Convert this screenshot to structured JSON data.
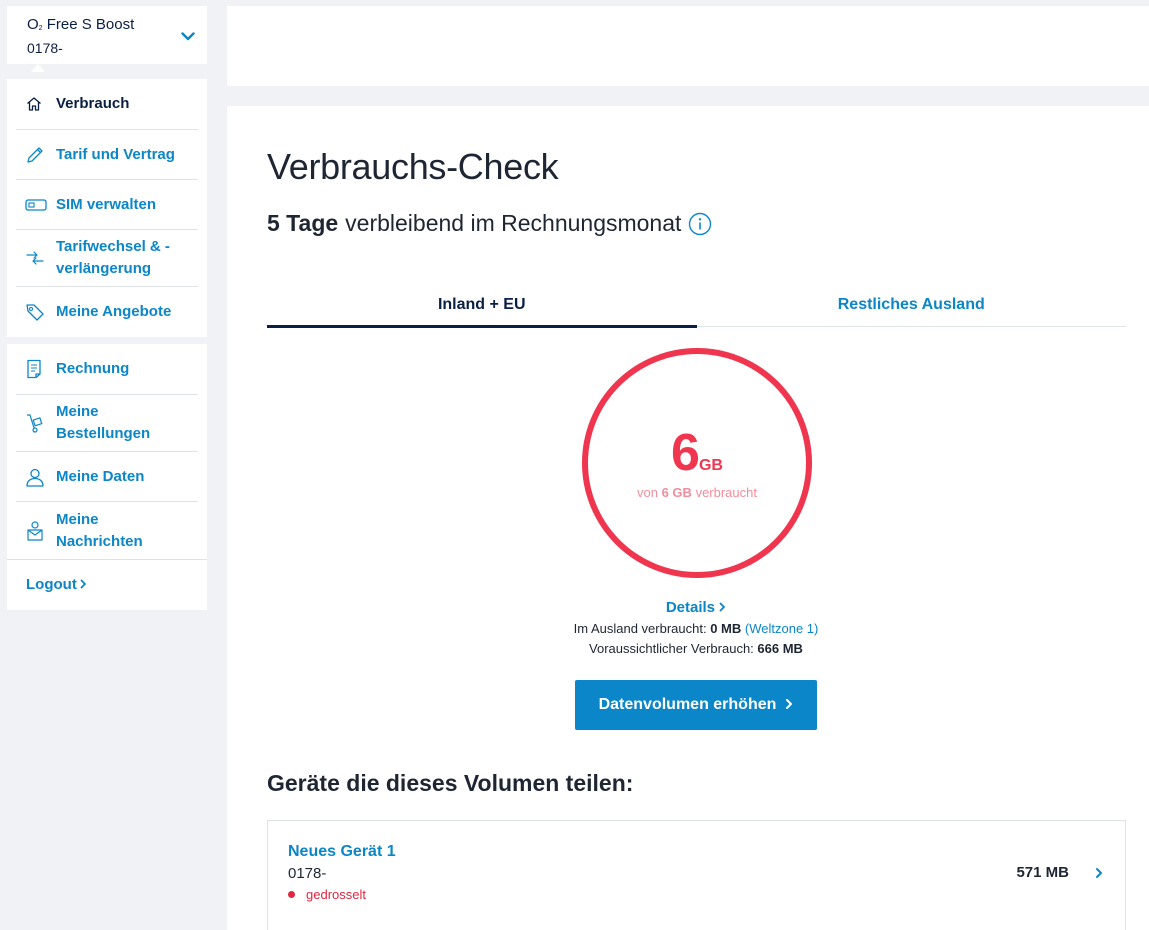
{
  "tariff": {
    "name_prefix": "O",
    "name_sub": "2",
    "name_rest": " Free S Boost",
    "number": "0178-"
  },
  "sidebar": {
    "items": [
      {
        "label": "Verbrauch",
        "icon": "home-icon",
        "active": true
      },
      {
        "label": "Tarif und Vertrag",
        "icon": "pencil-icon"
      },
      {
        "label": "SIM verwalten",
        "icon": "sim-card-icon"
      },
      {
        "label": "Tarifwechsel & -verlängerung",
        "line1": "Tarifwechsel & -",
        "line2": "verlängerung",
        "icon": "swap-icon"
      },
      {
        "label": "Meine Angebote",
        "icon": "tag-icon"
      }
    ],
    "items2": [
      {
        "label": "Rechnung",
        "icon": "invoice-icon"
      },
      {
        "label": "Meine Bestellungen",
        "line1": "Meine",
        "line2": "Bestellungen",
        "icon": "hand-truck-icon"
      },
      {
        "label": "Meine Daten",
        "icon": "user-icon"
      },
      {
        "label": "Meine Nachrichten",
        "line1": "Meine",
        "line2": "Nachrichten",
        "icon": "message-icon"
      }
    ],
    "logout": "Logout"
  },
  "main": {
    "title": "Verbrauchs-Check",
    "remaining_bold": "5 Tage",
    "remaining_text": "verbleibend im Rechnungsmonat",
    "tabs": [
      {
        "label": "Inland + EU",
        "active": true
      },
      {
        "label": "Restliches Ausland",
        "active": false
      }
    ],
    "gauge": {
      "value": "6",
      "unit": "GB",
      "sub_prefix": "von",
      "sub_total": "6 GB",
      "sub_suffix": "verbraucht",
      "fraction_used": 1.0
    },
    "details_label": "Details",
    "abroad_label": "Im Ausland verbraucht:",
    "abroad_value": "0 MB",
    "abroad_zone": "(Weltzone 1)",
    "forecast_label": "Voraussichtlicher Verbrauch:",
    "forecast_value": "666 MB",
    "cta_label": "Datenvolumen erhöhen",
    "devices_title": "Geräte die dieses Volumen teilen:",
    "devices": [
      {
        "name": "Neues Gerät 1",
        "number": "0178-",
        "status": "gedrosselt",
        "usage": "571 MB"
      }
    ]
  },
  "colors": {
    "accent": "#0b86c8",
    "navy": "#0a1f44",
    "gauge": "#f0364f"
  }
}
